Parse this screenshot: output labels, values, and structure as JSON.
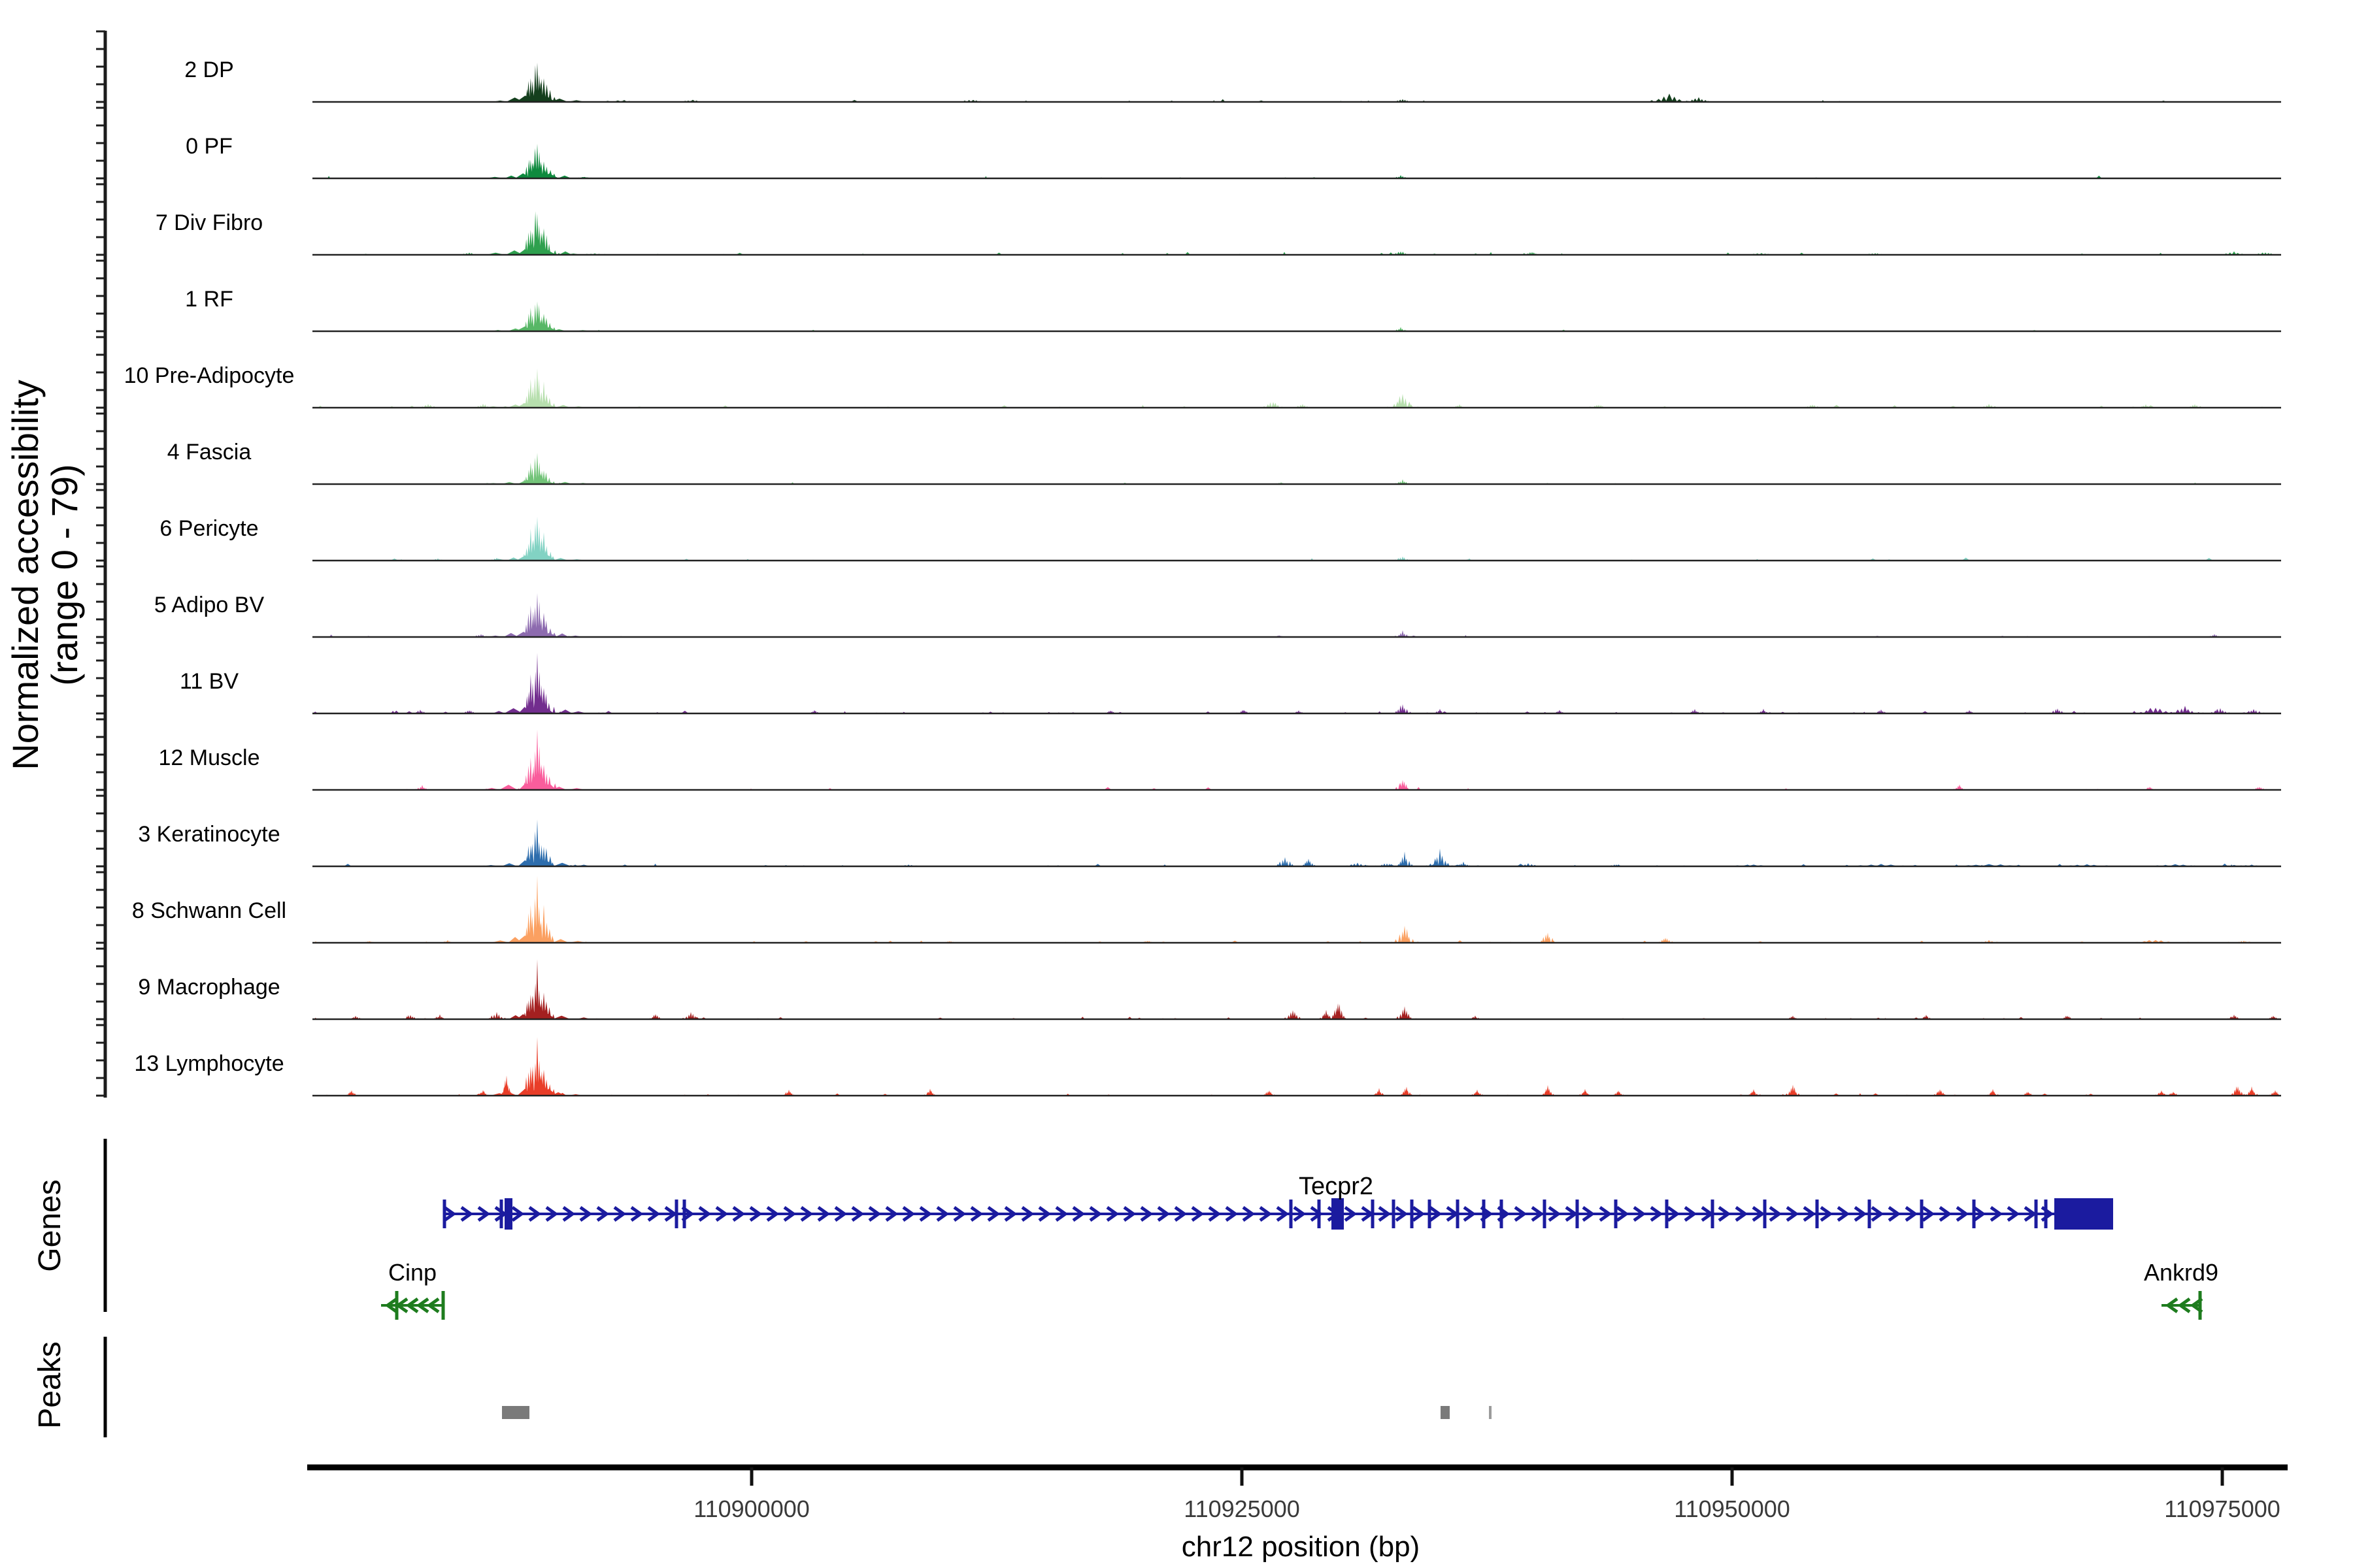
{
  "chart_data": {
    "type": "area",
    "title": "",
    "region": {
      "chromosome": "chr12",
      "start": 110877600,
      "end": 110978000,
      "units": "bp"
    },
    "xlabel": "chr12 position (bp)",
    "ylabel_line1": "Normalized accessibility",
    "ylabel_line2": "(range 0 - 79)",
    "y_range": [
      0,
      79
    ],
    "xticks": [
      {
        "value": 110900000,
        "label": "110900000"
      },
      {
        "value": 110925000,
        "label": "110925000"
      },
      {
        "value": 110950000,
        "label": "110950000"
      },
      {
        "value": 110975000,
        "label": "110975000"
      }
    ],
    "main_peak_bp": 110889067,
    "tracks": [
      {
        "label": "2 DP",
        "color": "#143f1d",
        "main": 57,
        "noise": 26,
        "peaks": [
          [
            110911300,
            3,
            26
          ],
          [
            110933200,
            4,
            16
          ],
          [
            110946800,
            9,
            34
          ],
          [
            110948300,
            6,
            22
          ],
          [
            110893500,
            2,
            40
          ],
          [
            110897000,
            2.5,
            30
          ]
        ]
      },
      {
        "label": "0 PF",
        "color": "#0e8a3e",
        "main": 47,
        "noise": 10,
        "peaks": [
          [
            110933100,
            3.5,
            14
          ],
          [
            110891500,
            2,
            20
          ]
        ]
      },
      {
        "label": "7 Div Fibro",
        "color": "#2ea04e",
        "main": 61,
        "noise": 30,
        "peaks": [
          [
            110885600,
            3,
            18
          ],
          [
            110933100,
            5,
            16
          ],
          [
            110939800,
            4,
            14
          ],
          [
            110951500,
            2.5,
            26
          ],
          [
            110957300,
            2.5,
            20
          ],
          [
            110975600,
            3.5,
            26
          ],
          [
            110977200,
            3.5,
            22
          ],
          [
            110892000,
            2,
            30
          ]
        ]
      },
      {
        "label": "1 RF",
        "color": "#57b766",
        "main": 45,
        "noise": 8,
        "peaks": [
          [
            110933100,
            4.5,
            14
          ]
        ]
      },
      {
        "label": "10 Pre-Adipocyte",
        "color": "#b7dfae",
        "main": 53,
        "noise": 46,
        "peaks": [
          [
            110926600,
            8,
            18
          ],
          [
            110928100,
            5,
            14
          ],
          [
            110933200,
            18,
            20
          ],
          [
            110936100,
            3.5,
            12
          ],
          [
            110943200,
            4,
            14
          ],
          [
            110954100,
            4,
            16
          ],
          [
            110963100,
            4,
            18
          ],
          [
            110971100,
            3.5,
            14
          ],
          [
            110973600,
            4.5,
            16
          ],
          [
            110883500,
            4,
            18
          ],
          [
            110886300,
            5,
            16
          ]
        ]
      },
      {
        "label": "4 Fascia",
        "color": "#72c378",
        "main": 39,
        "noise": 10,
        "peaks": [
          [
            110933200,
            5.5,
            14
          ],
          [
            110927000,
            2,
            12
          ]
        ]
      },
      {
        "label": "6 Pericyte",
        "color": "#82d2c3",
        "main": 57,
        "noise": 24,
        "peaks": [
          [
            110933200,
            5.5,
            14
          ],
          [
            110936600,
            2.5,
            10
          ],
          [
            110884000,
            2.5,
            14
          ],
          [
            110887000,
            3,
            14
          ]
        ]
      },
      {
        "label": "5 Adipo BV",
        "color": "#8d6baf",
        "main": 57,
        "noise": 16,
        "peaks": [
          [
            110926900,
            2.5,
            10
          ],
          [
            110933200,
            7,
            13
          ],
          [
            110974600,
            3.5,
            12
          ],
          [
            110886200,
            3.5,
            16
          ]
        ]
      },
      {
        "label": "11 BV",
        "color": "#722d8e",
        "main": 71,
        "noise": 85,
        "peaks": [
          [
            110883100,
            4.5,
            14
          ],
          [
            110885600,
            4.5,
            12
          ],
          [
            110903200,
            4,
            10
          ],
          [
            110918300,
            4,
            10
          ],
          [
            110925100,
            5,
            10
          ],
          [
            110927900,
            4,
            10
          ],
          [
            110933200,
            12,
            14
          ],
          [
            110935100,
            5,
            10
          ],
          [
            110941200,
            4,
            10
          ],
          [
            110948100,
            5,
            12
          ],
          [
            110951600,
            5,
            10
          ],
          [
            110957600,
            5,
            12
          ],
          [
            110962100,
            4,
            10
          ],
          [
            110966600,
            6,
            14
          ],
          [
            110971600,
            8,
            34
          ],
          [
            110973100,
            8,
            26
          ],
          [
            110974900,
            7,
            20
          ],
          [
            110976600,
            6,
            18
          ]
        ]
      },
      {
        "label": "12 Muscle",
        "color": "#f95d9c",
        "main": 67,
        "noise": 24,
        "peaks": [
          [
            110883200,
            5,
            12
          ],
          [
            110933200,
            15,
            12
          ],
          [
            110961600,
            6,
            10
          ],
          [
            110971300,
            4,
            10
          ],
          [
            110976900,
            4,
            12
          ]
        ]
      },
      {
        "label": "3 Keratinocyte",
        "color": "#2d6dad",
        "main": 54,
        "noise": 60,
        "peaks": [
          [
            110927200,
            12,
            16
          ],
          [
            110928400,
            9,
            12
          ],
          [
            110930900,
            5,
            24
          ],
          [
            110932400,
            4,
            16
          ],
          [
            110933300,
            15,
            14
          ],
          [
            110935100,
            19,
            18
          ],
          [
            110936300,
            5,
            14
          ],
          [
            110939600,
            3.5,
            24
          ],
          [
            110944100,
            2.5,
            16
          ],
          [
            110951100,
            2,
            60
          ],
          [
            110957600,
            2.5,
            70
          ],
          [
            110963100,
            3,
            80
          ],
          [
            110968100,
            2.5,
            60
          ],
          [
            110972600,
            2.5,
            60
          ],
          [
            110976500,
            2,
            40
          ],
          [
            110891000,
            2,
            30
          ],
          [
            110908000,
            2,
            24
          ]
        ]
      },
      {
        "label": "8 Schwann Cell",
        "color": "#fba061",
        "main": 75,
        "noise": 42,
        "peaks": [
          [
            110910100,
            2.5,
            12
          ],
          [
            110920200,
            3,
            12
          ],
          [
            110933300,
            22,
            16
          ],
          [
            110940600,
            12,
            14
          ],
          [
            110946600,
            7,
            12
          ],
          [
            110963100,
            3,
            24
          ],
          [
            110971600,
            4,
            40
          ],
          [
            110976100,
            2.5,
            16
          ],
          [
            110880500,
            2.5,
            12
          ],
          [
            110884500,
            3,
            12
          ]
        ]
      },
      {
        "label": "9 Macrophage",
        "color": "#a42020",
        "main": 63,
        "noise": 55,
        "peaks": [
          [
            110879800,
            4,
            12
          ],
          [
            110882600,
            6,
            14
          ],
          [
            110884100,
            5,
            12
          ],
          [
            110887000,
            8,
            16
          ],
          [
            110895100,
            6,
            12
          ],
          [
            110896900,
            8,
            14
          ],
          [
            110927600,
            12,
            14
          ],
          [
            110929300,
            10,
            12
          ],
          [
            110929900,
            24,
            11
          ],
          [
            110933300,
            14,
            14
          ],
          [
            110936900,
            4,
            10
          ],
          [
            110953100,
            4,
            10
          ],
          [
            110959900,
            5,
            10
          ],
          [
            110967100,
            5,
            10
          ],
          [
            110975600,
            6,
            12
          ],
          [
            110977600,
            4,
            10
          ]
        ]
      },
      {
        "label": "13 Lymphocyte",
        "color": "#e93d28",
        "main": 69,
        "noise": 45,
        "peaks": [
          [
            110886300,
            7,
            9
          ],
          [
            110887500,
            24,
            9
          ],
          [
            110901900,
            7,
            10
          ],
          [
            110909100,
            8,
            10
          ],
          [
            110926400,
            7,
            10
          ],
          [
            110932000,
            8,
            10
          ],
          [
            110933400,
            10,
            10
          ],
          [
            110937000,
            7,
            10
          ],
          [
            110940600,
            11,
            10
          ],
          [
            110942500,
            8,
            9
          ],
          [
            110944200,
            7,
            9
          ],
          [
            110951100,
            7,
            10
          ],
          [
            110953100,
            13,
            12
          ],
          [
            110960600,
            8,
            10
          ],
          [
            110963300,
            7,
            9
          ],
          [
            110965100,
            5,
            9
          ],
          [
            110971900,
            6,
            10
          ],
          [
            110972500,
            5,
            9
          ],
          [
            110975800,
            13,
            12
          ],
          [
            110976500,
            10,
            10
          ],
          [
            110977700,
            7,
            10
          ],
          [
            110879600,
            6,
            10
          ]
        ]
      }
    ],
    "genes": [
      {
        "name": "Tecpr2",
        "color": "#1b1b9f",
        "strand": "+",
        "row": 0,
        "chevron_step": 26,
        "start": 110884333,
        "end": 110969433,
        "label_bp": 110929800,
        "exon_ticks": [
          110884333,
          110887233,
          110896167,
          110896567,
          110927500,
          110928933,
          110931667,
          110932733,
          110933667,
          110934567,
          110936000,
          110937333,
          110938233,
          110940433,
          110942100,
          110944067,
          110946667,
          110949000,
          110951667,
          110954333,
          110957000,
          110959667,
          110962333,
          110965500,
          110966000
        ],
        "exon_blocks": [
          [
            110887400,
            110887800
          ],
          [
            110929567,
            110930200
          ],
          [
            110966433,
            110969433
          ]
        ]
      },
      {
        "name": "Cinp",
        "color": "#1e7c1e",
        "strand": "-",
        "row": 1,
        "chevron_step": 16,
        "start": 110881100,
        "end": 110884267,
        "label_bp": 110882700,
        "exon_ticks": [
          110881900,
          110884267
        ],
        "exon_blocks": []
      },
      {
        "name": "Ankrd9",
        "color": "#1e7c1e",
        "strand": "-",
        "row": 1,
        "chevron_step": 19,
        "start": 110971900,
        "end": 110973933,
        "label_bp": 110972900,
        "exon_ticks": [
          110973867
        ],
        "exon_blocks": []
      }
    ],
    "peak_regions": [
      {
        "start": 110887267,
        "end": 110888667,
        "shade": "#7a7a7a"
      },
      {
        "start": 110935133,
        "end": 110935600,
        "shade": "#7a7a7a"
      },
      {
        "start": 110937600,
        "end": 110937733,
        "shade": "#9b9b9b"
      }
    ]
  },
  "sidebar": {
    "genes_label": "Genes",
    "peaks_label": "Peaks"
  }
}
